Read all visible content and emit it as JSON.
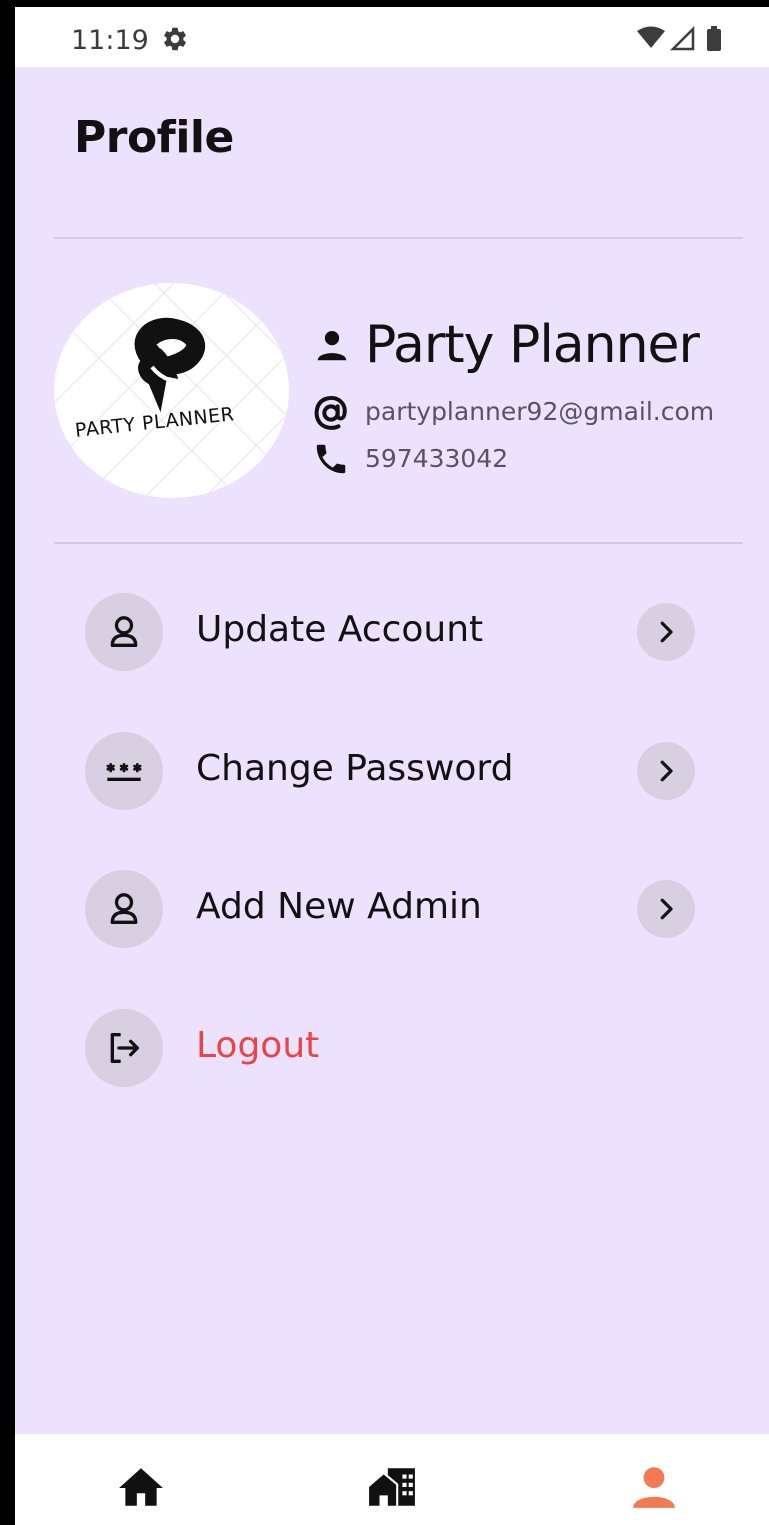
{
  "status_bar": {
    "time": "11:19",
    "icons": [
      "gear-icon",
      "wifi-icon",
      "signal-icon",
      "battery-icon"
    ]
  },
  "page": {
    "title": "Profile"
  },
  "profile": {
    "avatar_text": "PARTY PLANNER",
    "name": "Party Planner",
    "email": "partyplanner92@gmail.com",
    "phone": "597433042"
  },
  "menu": {
    "items": [
      {
        "label": "Update Account",
        "icon": "user-outline-icon"
      },
      {
        "label": "Change Password",
        "icon": "password-icon"
      },
      {
        "label": "Add New Admin",
        "icon": "user-outline-icon"
      },
      {
        "label": "Logout",
        "icon": "logout-icon"
      }
    ]
  },
  "bottom_nav": {
    "items": [
      {
        "name": "home",
        "icon": "home-icon",
        "active": false
      },
      {
        "name": "venues",
        "icon": "building-icon",
        "active": false
      },
      {
        "name": "profile",
        "icon": "person-icon",
        "active": true
      }
    ]
  },
  "colors": {
    "background": "#ede2fe",
    "accent": "#f47a52",
    "logout": "#e84545",
    "icon_circle": "#d8cfe3"
  }
}
